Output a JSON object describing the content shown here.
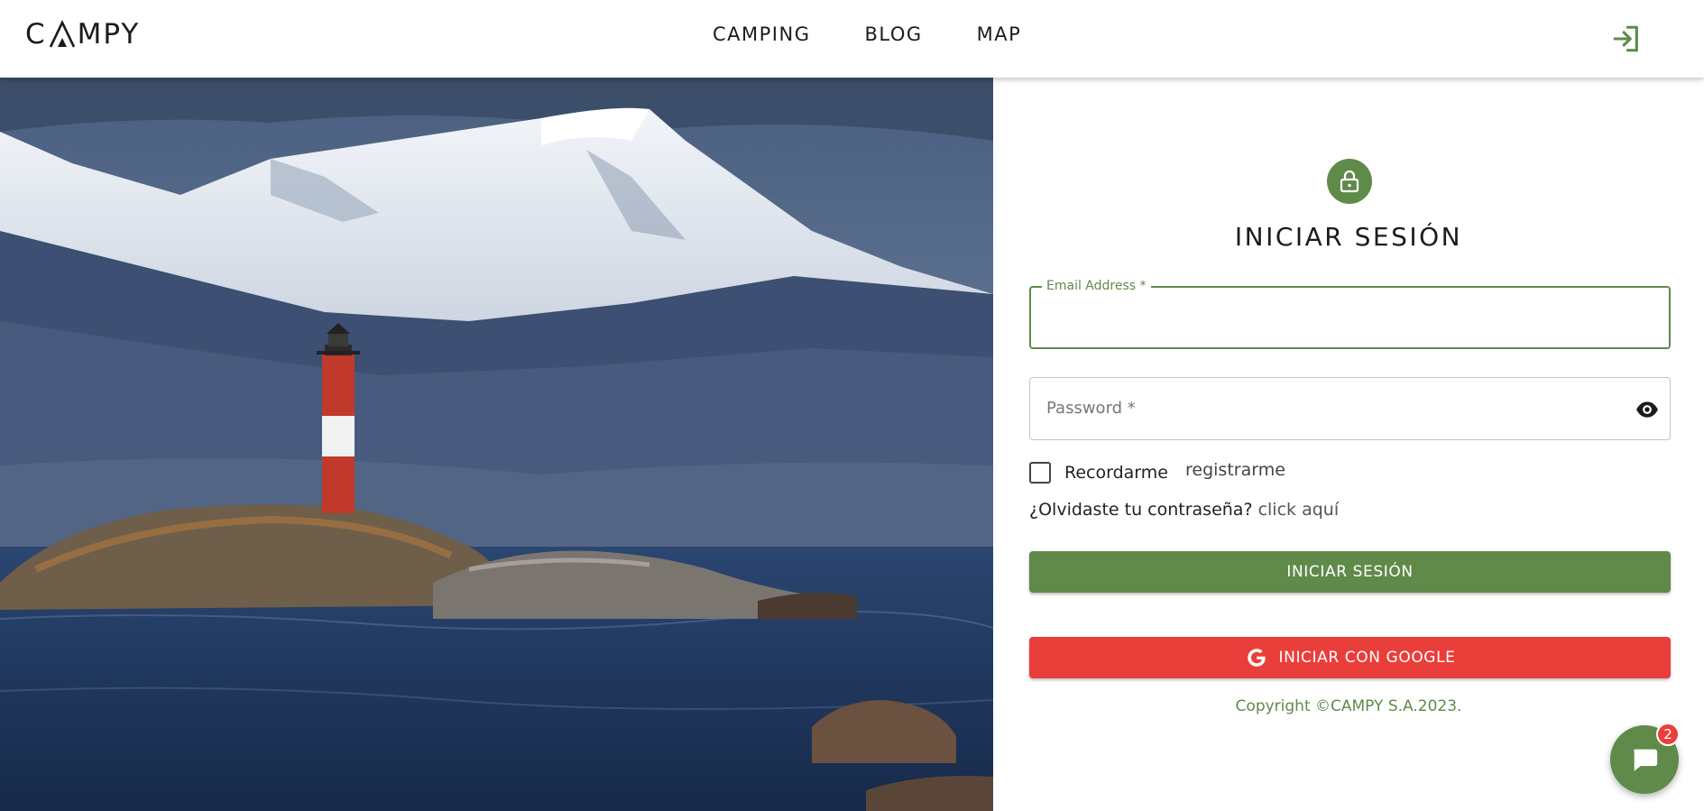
{
  "header": {
    "logo_text_left": "C",
    "logo_text_right": "MPY",
    "nav": [
      "CAMPING",
      "BLOG",
      "MAP"
    ]
  },
  "hero": {
    "image": "lighthouse-mountains-photo"
  },
  "login": {
    "title": "INICIAR SESIÓN",
    "email_label": "Email Address *",
    "email_value": "",
    "password_placeholder": "Password *",
    "remember_label": "Recordarme",
    "register_link": "registrarme",
    "forgot_text": "¿Olvidaste tu contraseña?",
    "forgot_link": "click aquí",
    "submit_label": "INICIAR SESIÓN",
    "google_label": "INICIAR CON GOOGLE",
    "copyright": "Copyright ©CAMPY S.A.2023."
  },
  "chat": {
    "badge_count": "2"
  },
  "colors": {
    "accent": "#5f8a4a",
    "google": "#ea3e3a"
  },
  "icons": [
    "tent-logo-icon",
    "login-icon",
    "lock-icon",
    "eye-icon",
    "google-icon",
    "chat-icon"
  ]
}
